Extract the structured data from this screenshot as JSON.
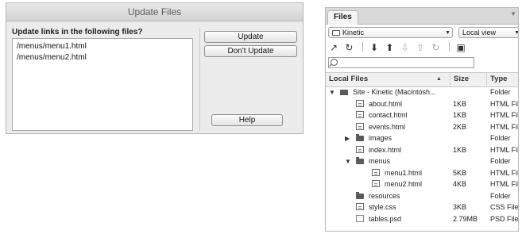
{
  "dialog": {
    "title": "Update Files",
    "prompt": "Update links in the following files?",
    "files": [
      "/menus/menu1.html",
      "/menus/menu2.html"
    ],
    "buttons": {
      "update": "Update",
      "dont_update": "Don't Update",
      "help": "Help"
    }
  },
  "files_panel": {
    "tab_label": "Files",
    "site_select": "Kinetic",
    "view_select": "Local view",
    "columns": {
      "name": "Local Files",
      "size": "Size",
      "type": "Type"
    },
    "rows": [
      {
        "name": "Site - Kinetic (Macintosh...",
        "size": "",
        "type": "Folder",
        "kind": "site",
        "level": 0,
        "expanded": true
      },
      {
        "name": "about.html",
        "size": "1KB",
        "type": "HTML File",
        "kind": "file",
        "level": 1
      },
      {
        "name": "contact.html",
        "size": "1KB",
        "type": "HTML File",
        "kind": "file",
        "level": 1
      },
      {
        "name": "events.html",
        "size": "2KB",
        "type": "HTML File",
        "kind": "file",
        "level": 1
      },
      {
        "name": "images",
        "size": "",
        "type": "Folder",
        "kind": "folder",
        "level": 1,
        "expanded": false
      },
      {
        "name": "index.html",
        "size": "1KB",
        "type": "HTML File",
        "kind": "file",
        "level": 1
      },
      {
        "name": "menus",
        "size": "",
        "type": "Folder",
        "kind": "folder",
        "level": 1,
        "expanded": true
      },
      {
        "name": "menu1.html",
        "size": "5KB",
        "type": "HTML File",
        "kind": "file",
        "level": 2
      },
      {
        "name": "menu2.html",
        "size": "4KB",
        "type": "HTML File",
        "kind": "file",
        "level": 2
      },
      {
        "name": "resources",
        "size": "",
        "type": "Folder",
        "kind": "folder",
        "level": 1
      },
      {
        "name": "style.css",
        "size": "3KB",
        "type": "CSS File",
        "kind": "file",
        "level": 1
      },
      {
        "name": "tables.psd",
        "size": "2.79MB",
        "type": "PSD File",
        "kind": "psd",
        "level": 1
      }
    ]
  }
}
